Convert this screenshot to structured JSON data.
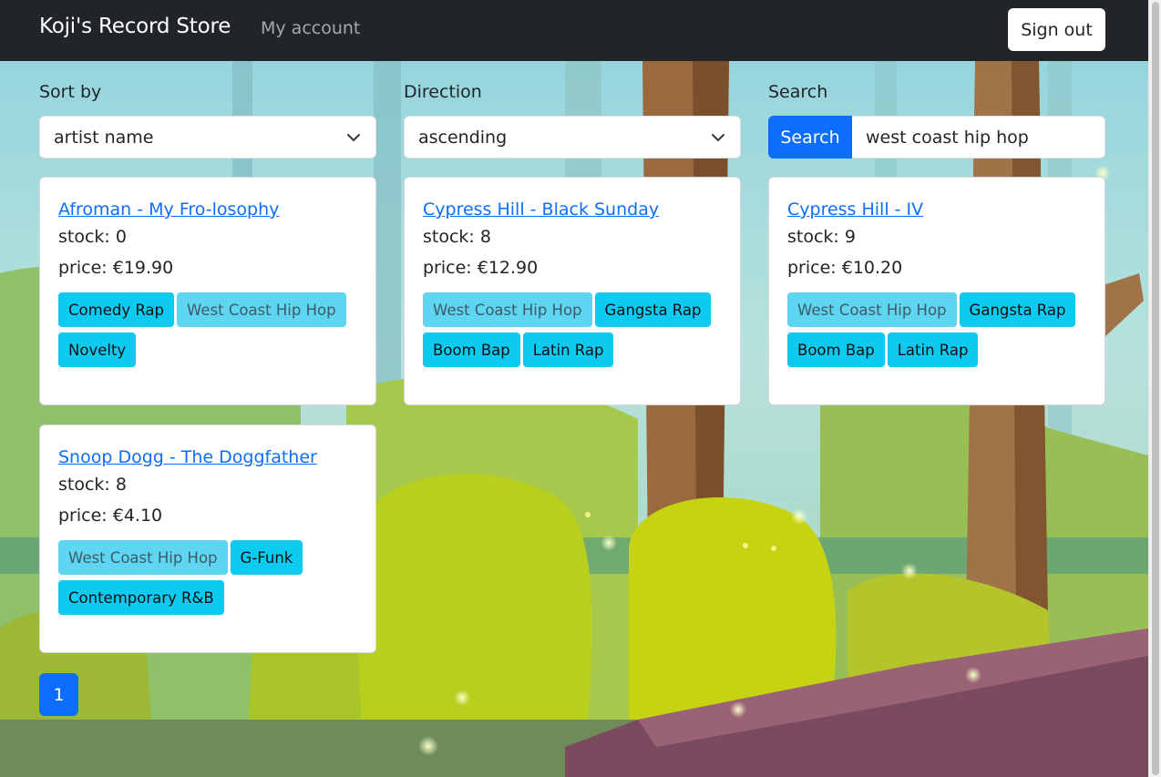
{
  "navbar": {
    "brand": "Koji's Record Store",
    "my_account": "My account",
    "sign_out": "Sign out"
  },
  "filters": {
    "sort_by": {
      "label": "Sort by",
      "value": "artist name"
    },
    "direction": {
      "label": "Direction",
      "value": "ascending"
    },
    "search": {
      "label": "Search",
      "button": "Search",
      "value": "west coast hip hop"
    }
  },
  "records": [
    {
      "title": "Afroman - My Fro-losophy",
      "stock": "stock: 0",
      "price": "price: €19.90",
      "tags": [
        {
          "name": "Comedy Rap",
          "active": false
        },
        {
          "name": "West Coast Hip Hop",
          "active": true
        },
        {
          "name": "Novelty",
          "active": false
        }
      ]
    },
    {
      "title": "Cypress Hill - Black Sunday",
      "stock": "stock: 8",
      "price": "price: €12.90",
      "tags": [
        {
          "name": "West Coast Hip Hop",
          "active": true
        },
        {
          "name": "Gangsta Rap",
          "active": false
        },
        {
          "name": "Boom Bap",
          "active": false
        },
        {
          "name": "Latin Rap",
          "active": false
        }
      ]
    },
    {
      "title": "Cypress Hill - IV",
      "stock": "stock: 9",
      "price": "price: €10.20",
      "tags": [
        {
          "name": "West Coast Hip Hop",
          "active": true
        },
        {
          "name": "Gangsta Rap",
          "active": false
        },
        {
          "name": "Boom Bap",
          "active": false
        },
        {
          "name": "Latin Rap",
          "active": false
        }
      ]
    },
    {
      "title": "Snoop Dogg - The Doggfather",
      "stock": "stock: 8",
      "price": "price: €4.10",
      "tags": [
        {
          "name": "West Coast Hip Hop",
          "active": true
        },
        {
          "name": "G-Funk",
          "active": false
        },
        {
          "name": "Contemporary R&B",
          "active": false
        }
      ]
    }
  ],
  "pagination": {
    "current_page": "1"
  },
  "colors": {
    "navbar": "#212529",
    "primary": "#0d6efd",
    "tag": "#0dcaf0",
    "tag_active": "#5fd6f1"
  }
}
